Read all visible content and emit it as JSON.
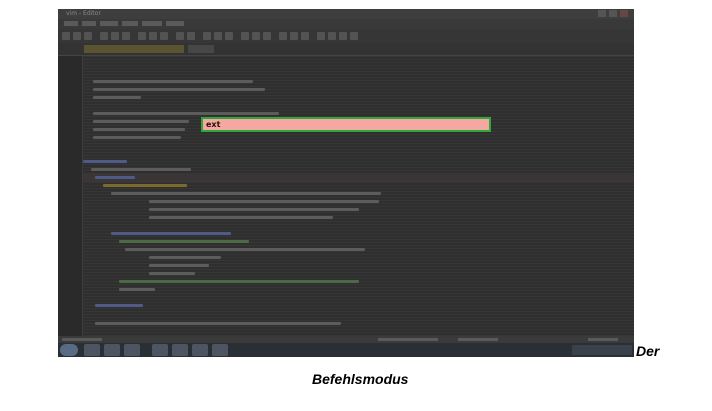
{
  "window": {
    "title": "vim - Editor"
  },
  "command_line": {
    "value": "ext"
  },
  "caption": {
    "line1": "Der",
    "line2": "Befehlsmodus"
  },
  "colors": {
    "command_box_fill": "#f5a7a1",
    "command_box_border": "#2fa83a",
    "editor_background": "#2f2f2f"
  },
  "icons": {
    "window_controls": [
      "minimize-icon",
      "maximize-icon",
      "close-icon"
    ],
    "taskbar": [
      "start-icon",
      "explorer-icon",
      "media-player-icon",
      "app-icon",
      "browser-icon",
      "chrome-icon",
      "app-icon-2"
    ]
  }
}
